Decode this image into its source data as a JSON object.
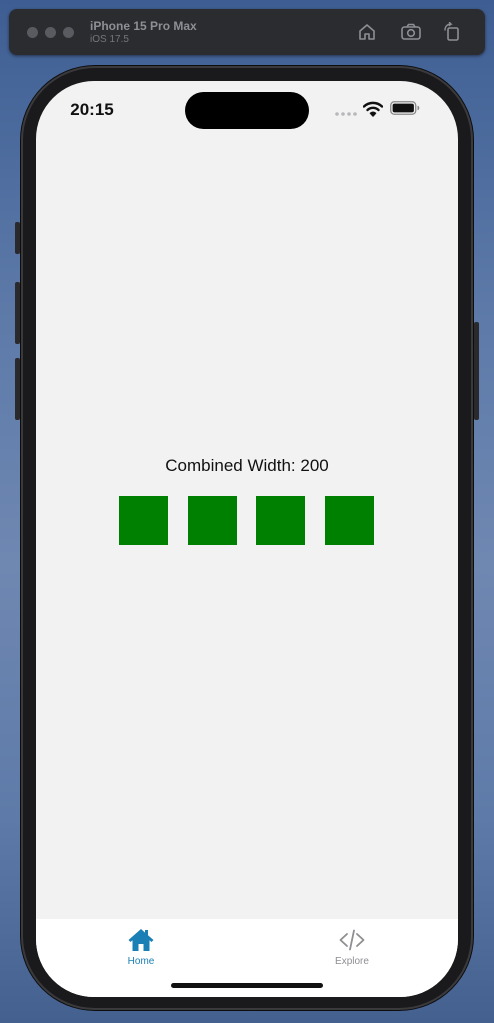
{
  "simulator": {
    "device_name": "iPhone 15 Pro Max",
    "os_version": "iOS 17.5",
    "home_icon": "home-icon",
    "screenshot_icon": "camera-icon",
    "rotate_icon": "rotate-icon"
  },
  "status_bar": {
    "time": "20:15"
  },
  "content": {
    "caption": "Combined Width: 200",
    "square_color": "#008000",
    "square_count": 4
  },
  "tab_bar": {
    "active_color": "#1a7fb5",
    "inactive_color": "#8e8e93",
    "tabs": [
      {
        "label": "Home",
        "icon": "house-icon",
        "active": true
      },
      {
        "label": "Explore",
        "icon": "code-icon",
        "active": false
      }
    ]
  }
}
